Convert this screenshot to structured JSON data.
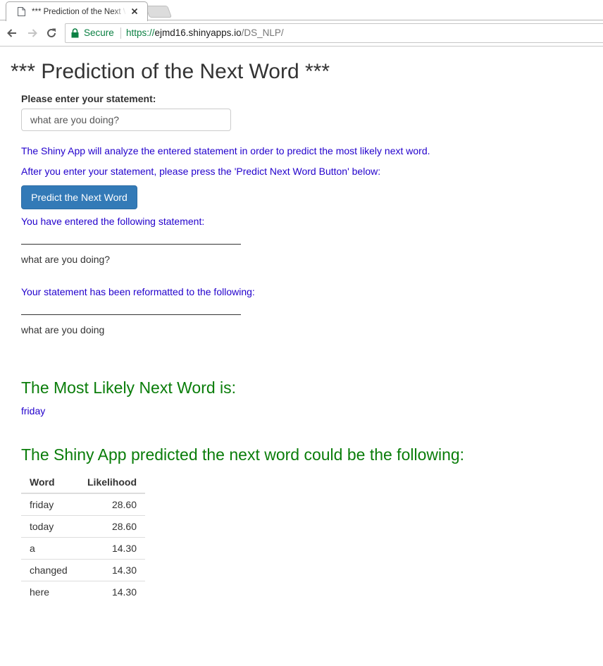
{
  "browser": {
    "tab_title": "*** Prediction of the Next Word ***",
    "secure_label": "Secure",
    "url_scheme": "https://",
    "url_host": "ejmd16.shinyapps.io",
    "url_path": "/DS_NLP/",
    "icons": [
      "page-icon",
      "close-icon",
      "back-arrow-icon",
      "forward-arrow-icon",
      "reload-icon",
      "lock-icon"
    ],
    "colors": {
      "secure": "#0b8043"
    }
  },
  "page": {
    "title": "*** Prediction of the Next Word ***",
    "statement_label": "Please enter your statement:",
    "statement_value": "what are you doing?",
    "info_1": "The Shiny App will analyze the entered statement in order to predict the most likely next word.",
    "info_2": "After you enter your statement, please press the 'Predict Next Word Button' below:",
    "predict_button": "Predict the Next Word",
    "entered_label": "You have entered the following statement:",
    "entered_value": "what are you doing?",
    "reformatted_label": "Your statement has been reformatted to the following:",
    "reformatted_value": "what are you doing",
    "most_likely_heading": "The Most Likely Next Word is:",
    "most_likely_word": "friday",
    "predictions_heading": "The Shiny App predicted the next word could be the following:",
    "colors": {
      "link_text": "#2200cc",
      "heading_green": "#0a7d0a",
      "button": "#337ab7"
    }
  },
  "table": {
    "headers": [
      "Word",
      "Likelihood"
    ],
    "rows": [
      [
        "friday",
        "28.60"
      ],
      [
        "today",
        "28.60"
      ],
      [
        "a",
        "14.30"
      ],
      [
        "changed",
        "14.30"
      ],
      [
        "here",
        "14.30"
      ]
    ]
  }
}
